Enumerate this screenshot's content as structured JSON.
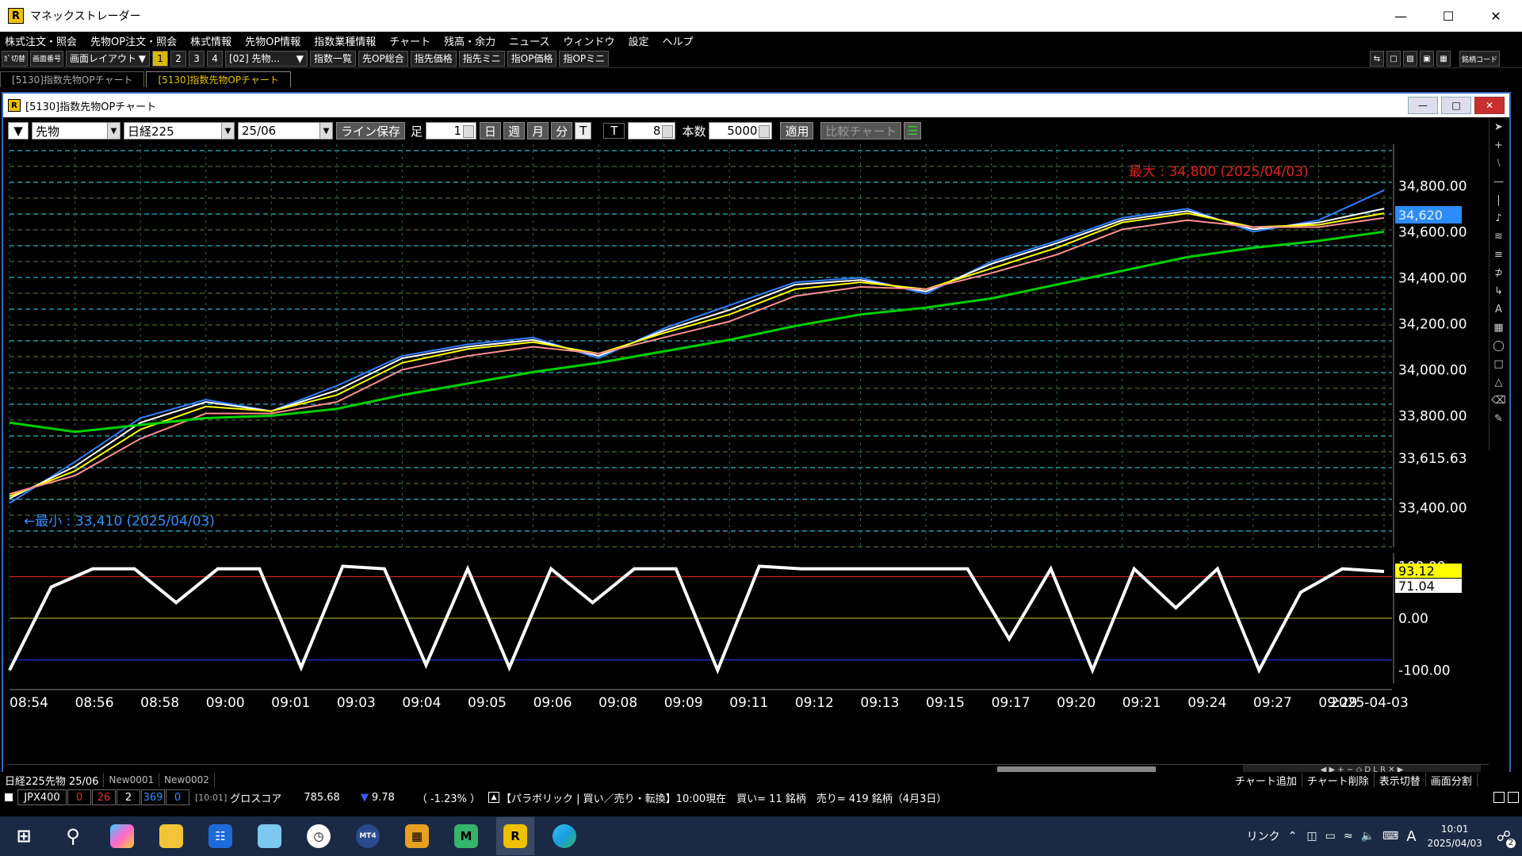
{
  "app": {
    "title": "マネックストレーダー",
    "logo": "R"
  },
  "menu": [
    "株式注文・照会",
    "先物OP注文・照会",
    "株式情報",
    "先物OP情報",
    "指数業種情報",
    "チャート",
    "残高・余力",
    "ニュース",
    "ウィンドウ",
    "設定",
    "ヘルプ"
  ],
  "toolbar": {
    "switch": "ｶﾞ切替",
    "screen_num": "画面番号",
    "layout": "画面レイアウト",
    "nums": [
      "1",
      "2",
      "3",
      "4"
    ],
    "preset": "[02] 先物...",
    "buttons": [
      "指数一覧",
      "先OP総合",
      "指先価格",
      "指先ミニ",
      "指OP価格",
      "指OPミニ"
    ],
    "code": "銘柄コード"
  },
  "tabs": [
    "[5130]指数先物OPチャート",
    "[5130]指数先物OPチャート"
  ],
  "chart_window": {
    "title": "[5130]指数先物OPチャート",
    "logo": "R",
    "type": "先物",
    "index": "日経225",
    "month": "25/06",
    "save": "ライン保存",
    "ashi": "足",
    "ashi_val": "1",
    "periods": [
      "日",
      "週",
      "月",
      "分",
      "T"
    ],
    "t_label": "T",
    "t_val": "8",
    "count_label": "本数",
    "count_val": "5000",
    "apply": "適用",
    "compare": "比較チャート"
  },
  "chart_data": [
    {
      "type": "line",
      "title": "",
      "x": [
        "08:54",
        "08:56",
        "08:58",
        "09:00",
        "09:01",
        "09:03",
        "09:04",
        "09:05",
        "09:06",
        "09:08",
        "09:09",
        "09:11",
        "09:12",
        "09:13",
        "09:15",
        "09:17",
        "09:20",
        "09:21",
        "09:24",
        "09:27",
        "09:29",
        "2025-04-03"
      ],
      "ylim": [
        33230,
        34980
      ],
      "yticks": [
        "34,800.00",
        "34,600.00",
        "34,400.00",
        "34,200.00",
        "34,000.00",
        "33,800.00",
        "33,615.63",
        "33,400.00"
      ],
      "last_price": "34,620",
      "max_label": "最大 : 34,800 (2025/04/03)",
      "min_label": "←最小 : 33,410 (2025/04/03)",
      "series": [
        {
          "color": "#3080ff",
          "values": [
            33420,
            33600,
            33790,
            33870,
            33820,
            33930,
            34060,
            34110,
            34140,
            34050,
            34180,
            34280,
            34380,
            34400,
            34330,
            34470,
            34560,
            34660,
            34700,
            34600,
            34650,
            34780
          ]
        },
        {
          "color": "#ffffff",
          "values": [
            33440,
            33580,
            33770,
            33860,
            33820,
            33910,
            34050,
            34100,
            34130,
            34060,
            34170,
            34260,
            34370,
            34390,
            34340,
            34460,
            34550,
            34650,
            34690,
            34610,
            34640,
            34700
          ]
        },
        {
          "color": "#ffff00",
          "values": [
            33450,
            33560,
            33740,
            33840,
            33820,
            33890,
            34030,
            34090,
            34120,
            34070,
            34160,
            34240,
            34350,
            34380,
            34350,
            34440,
            34530,
            34640,
            34680,
            34620,
            34630,
            34680
          ]
        },
        {
          "color": "#ff9090",
          "values": [
            33460,
            33540,
            33700,
            33810,
            33810,
            33860,
            34000,
            34060,
            34100,
            34070,
            34140,
            34210,
            34320,
            34360,
            34350,
            34420,
            34500,
            34610,
            34650,
            34620,
            34620,
            34660
          ]
        },
        {
          "color": "#00d000",
          "values": [
            33770,
            33730,
            33760,
            33790,
            33800,
            33830,
            33890,
            33940,
            33990,
            34030,
            34080,
            34130,
            34190,
            34240,
            34270,
            34310,
            34370,
            34430,
            34490,
            34530,
            34560,
            34600
          ]
        }
      ]
    },
    {
      "type": "line",
      "title": "",
      "ylim": [
        -125,
        125
      ],
      "yticks": [
        "100.00",
        "0.00",
        "-100.00"
      ],
      "labels": [
        "93.12",
        "71.04"
      ],
      "series": [
        {
          "color": "#ffffff",
          "values": [
            -100,
            60,
            95,
            95,
            30,
            95,
            95,
            -95,
            100,
            95,
            -90,
            95,
            -95,
            95,
            30,
            95,
            95,
            -100,
            100,
            95,
            95,
            95,
            95,
            95,
            -40,
            95,
            -100,
            95,
            20,
            95,
            -100,
            50,
            95,
            90
          ]
        }
      ]
    }
  ],
  "bottom_tabs": [
    "日経225先物 25/06",
    "New0001",
    "New0002"
  ],
  "bottom_buttons": [
    "チャート追加",
    "チャート削除",
    "表示切替",
    "画面分割"
  ],
  "status": {
    "name": "JPX400",
    "v1": "0",
    "v2": "26",
    "v3": "2",
    "v4": "369",
    "v5": "0",
    "time": "[10:01]",
    "g_label": "グロスコア",
    "g_val": "785.68",
    "chg": "9.78",
    "pct": "（ -1.23% ）",
    "news": "【パラボリック | 買い／売り・転換】10:00現在　買い= 11 銘柄　売り= 419 銘柄（4月3日）"
  },
  "taskbar": {
    "link": "リンク",
    "ime": "A",
    "time": "10:01",
    "date": "2025/04/03",
    "notify": "2"
  }
}
